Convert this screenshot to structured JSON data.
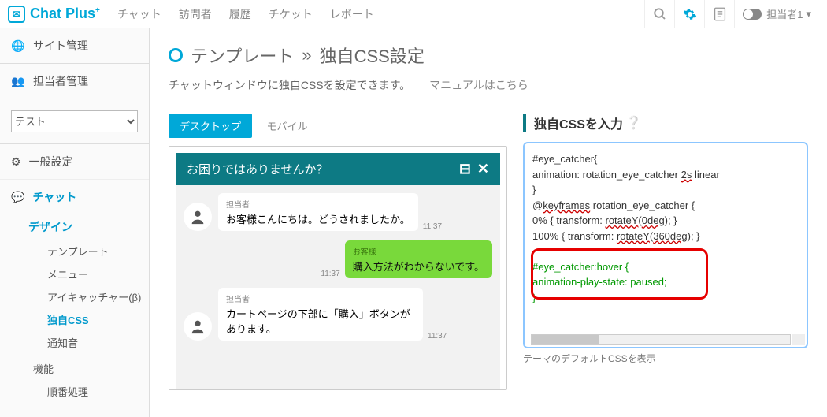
{
  "brand": {
    "name": "Chat Plus",
    "sup": "+"
  },
  "topnav": {
    "items": [
      "チャット",
      "訪問者",
      "履歴",
      "チケット",
      "レポート"
    ],
    "user": "担当者1",
    "user_caret": "▾"
  },
  "sidebar": {
    "site_admin": "サイト管理",
    "agent_admin": "担当者管理",
    "select_value": "テスト",
    "general": "一般設定",
    "chat_head": "チャット",
    "design": "デザイン",
    "design_items": [
      "テンプレート",
      "メニュー",
      "アイキャッチャー(β)",
      "独自CSS",
      "通知音"
    ],
    "active_index": 3,
    "function_label": "機能",
    "function_items": [
      "順番処理"
    ]
  },
  "page": {
    "breadcrumb_a": "テンプレート",
    "sep": "»",
    "breadcrumb_b": "独自CSS設定",
    "subtitle": "チャットウィンドウに独自CSSを設定できます。",
    "manual_link": "マニュアルはこちら"
  },
  "tabs": {
    "desktop": "デスクトップ",
    "mobile": "モバイル"
  },
  "chat": {
    "header": "お困りではありませんか？",
    "messages": [
      {
        "side": "left",
        "label": "担当者",
        "text": "お客様こんにちは。どうされましたか。",
        "time": "11:37"
      },
      {
        "side": "right",
        "label": "お客様",
        "text": "購入方法がわからないです。",
        "time": "11:37"
      },
      {
        "side": "left",
        "label": "担当者",
        "text": "カートページの下部に「購入」ボタンがあります。",
        "time": "11:37"
      }
    ]
  },
  "right": {
    "title": "独自CSSを入力",
    "default_css_link": "テーマのデフォルトCSSを表示",
    "css_lines": [
      [
        {
          "t": "#eye_catcher{",
          "c": ""
        }
      ],
      [
        {
          "t": "animation: rotation_eye_catcher ",
          "c": ""
        },
        {
          "t": "2s",
          "c": "linked"
        },
        {
          "t": " linear",
          "c": ""
        }
      ],
      [
        {
          "t": "}",
          "c": ""
        }
      ],
      [
        {
          "t": "@",
          "c": ""
        },
        {
          "t": "keyframes",
          "c": "linked"
        },
        {
          "t": " rotation_eye_catcher {",
          "c": ""
        }
      ],
      [
        {
          "t": "0% { transform: ",
          "c": ""
        },
        {
          "t": "rotateY",
          "c": "linked"
        },
        {
          "t": "(",
          "c": ""
        },
        {
          "t": "0deg",
          "c": "linked"
        },
        {
          "t": "); }",
          "c": ""
        }
      ],
      [
        {
          "t": "100% { transform: ",
          "c": ""
        },
        {
          "t": "rotateY",
          "c": "linked"
        },
        {
          "t": "(",
          "c": ""
        },
        {
          "t": "360deg",
          "c": "linked"
        },
        {
          "t": "); }",
          "c": ""
        }
      ],
      [
        {
          "t": "",
          "c": ""
        }
      ],
      [
        {
          "t": "#eye_catcher:hover {",
          "c": "green"
        }
      ],
      [
        {
          "t": "animation-play-state: paused;",
          "c": "green"
        }
      ],
      [
        {
          "t": "}",
          "c": "green"
        }
      ]
    ]
  }
}
